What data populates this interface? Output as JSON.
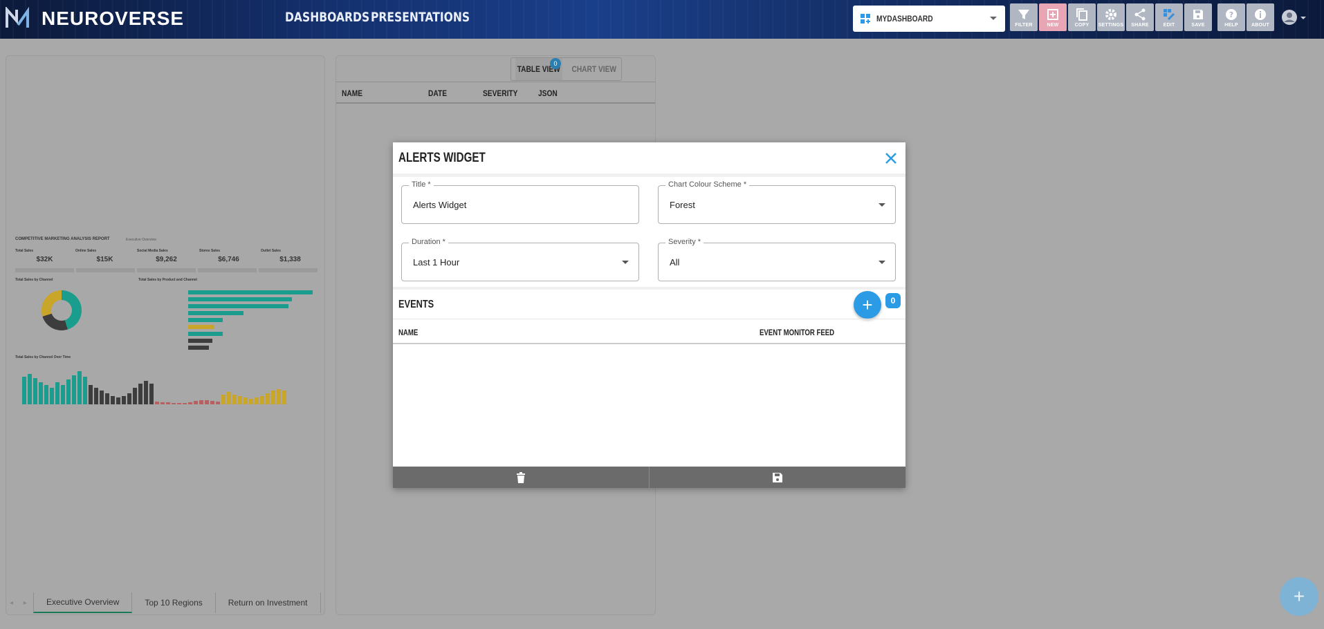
{
  "header": {
    "brand": "NEUROVERSE",
    "nav": [
      "DASHBOARDS",
      "PRESENTATIONS"
    ],
    "dashboard_select": "MYDASHBOARD",
    "tools": [
      {
        "label": "FILTER",
        "icon": "filter-icon"
      },
      {
        "label": "NEW",
        "icon": "new-icon"
      },
      {
        "label": "COPY",
        "icon": "copy-icon"
      },
      {
        "label": "SETTINGS",
        "icon": "settings-icon"
      },
      {
        "label": "SHARE",
        "icon": "share-icon"
      },
      {
        "label": "EDIT",
        "icon": "edit-icon"
      },
      {
        "label": "SAVE",
        "icon": "save-icon"
      },
      {
        "label": "HELP",
        "icon": "help-icon"
      },
      {
        "label": "ABOUT",
        "icon": "about-icon"
      }
    ]
  },
  "report": {
    "title": "COMPETITIVE MARKETING ANALYSIS REPORT",
    "subtitle": "Executive Overview",
    "kpis": [
      {
        "label": "Total Sales",
        "value": "$32K"
      },
      {
        "label": "Online Sales",
        "value": "$15K"
      },
      {
        "label": "Social Media Sales",
        "value": "$9,262"
      },
      {
        "label": "Stores Sales",
        "value": "$6,746"
      },
      {
        "label": "Outlet Sales",
        "value": "$1,338"
      }
    ],
    "sections": {
      "by_channel": "Total Sales by Channel",
      "by_product": "Total Sales by Product and Channel",
      "over_time": "Total Sales by Channel Over Time"
    }
  },
  "sheet_tabs": [
    "Executive Overview",
    "Top 10 Regions",
    "Return on Investment"
  ],
  "mid_panel": {
    "view_toggle": [
      "TABLE VIEW",
      "CHART VIEW"
    ],
    "badge": "0",
    "columns": [
      "NAME",
      "DATE",
      "SEVERITY",
      "JSON"
    ]
  },
  "modal": {
    "title": "ALERTS WIDGET",
    "fields": {
      "title": {
        "label": "Title *",
        "value": "Alerts Widget"
      },
      "chart_colour": {
        "label": "Chart Colour Scheme *",
        "value": "Forest"
      },
      "duration": {
        "label": "Duration *",
        "value": "Last 1 Hour"
      },
      "severity": {
        "label": "Severity *",
        "value": "All"
      }
    },
    "events_title": "EVENTS",
    "events_count": "0",
    "events_columns": [
      "NAME",
      "EVENT MONITOR FEED"
    ]
  },
  "colors": {
    "accent": "#2c9be6",
    "footer": "#6b6b6b"
  }
}
